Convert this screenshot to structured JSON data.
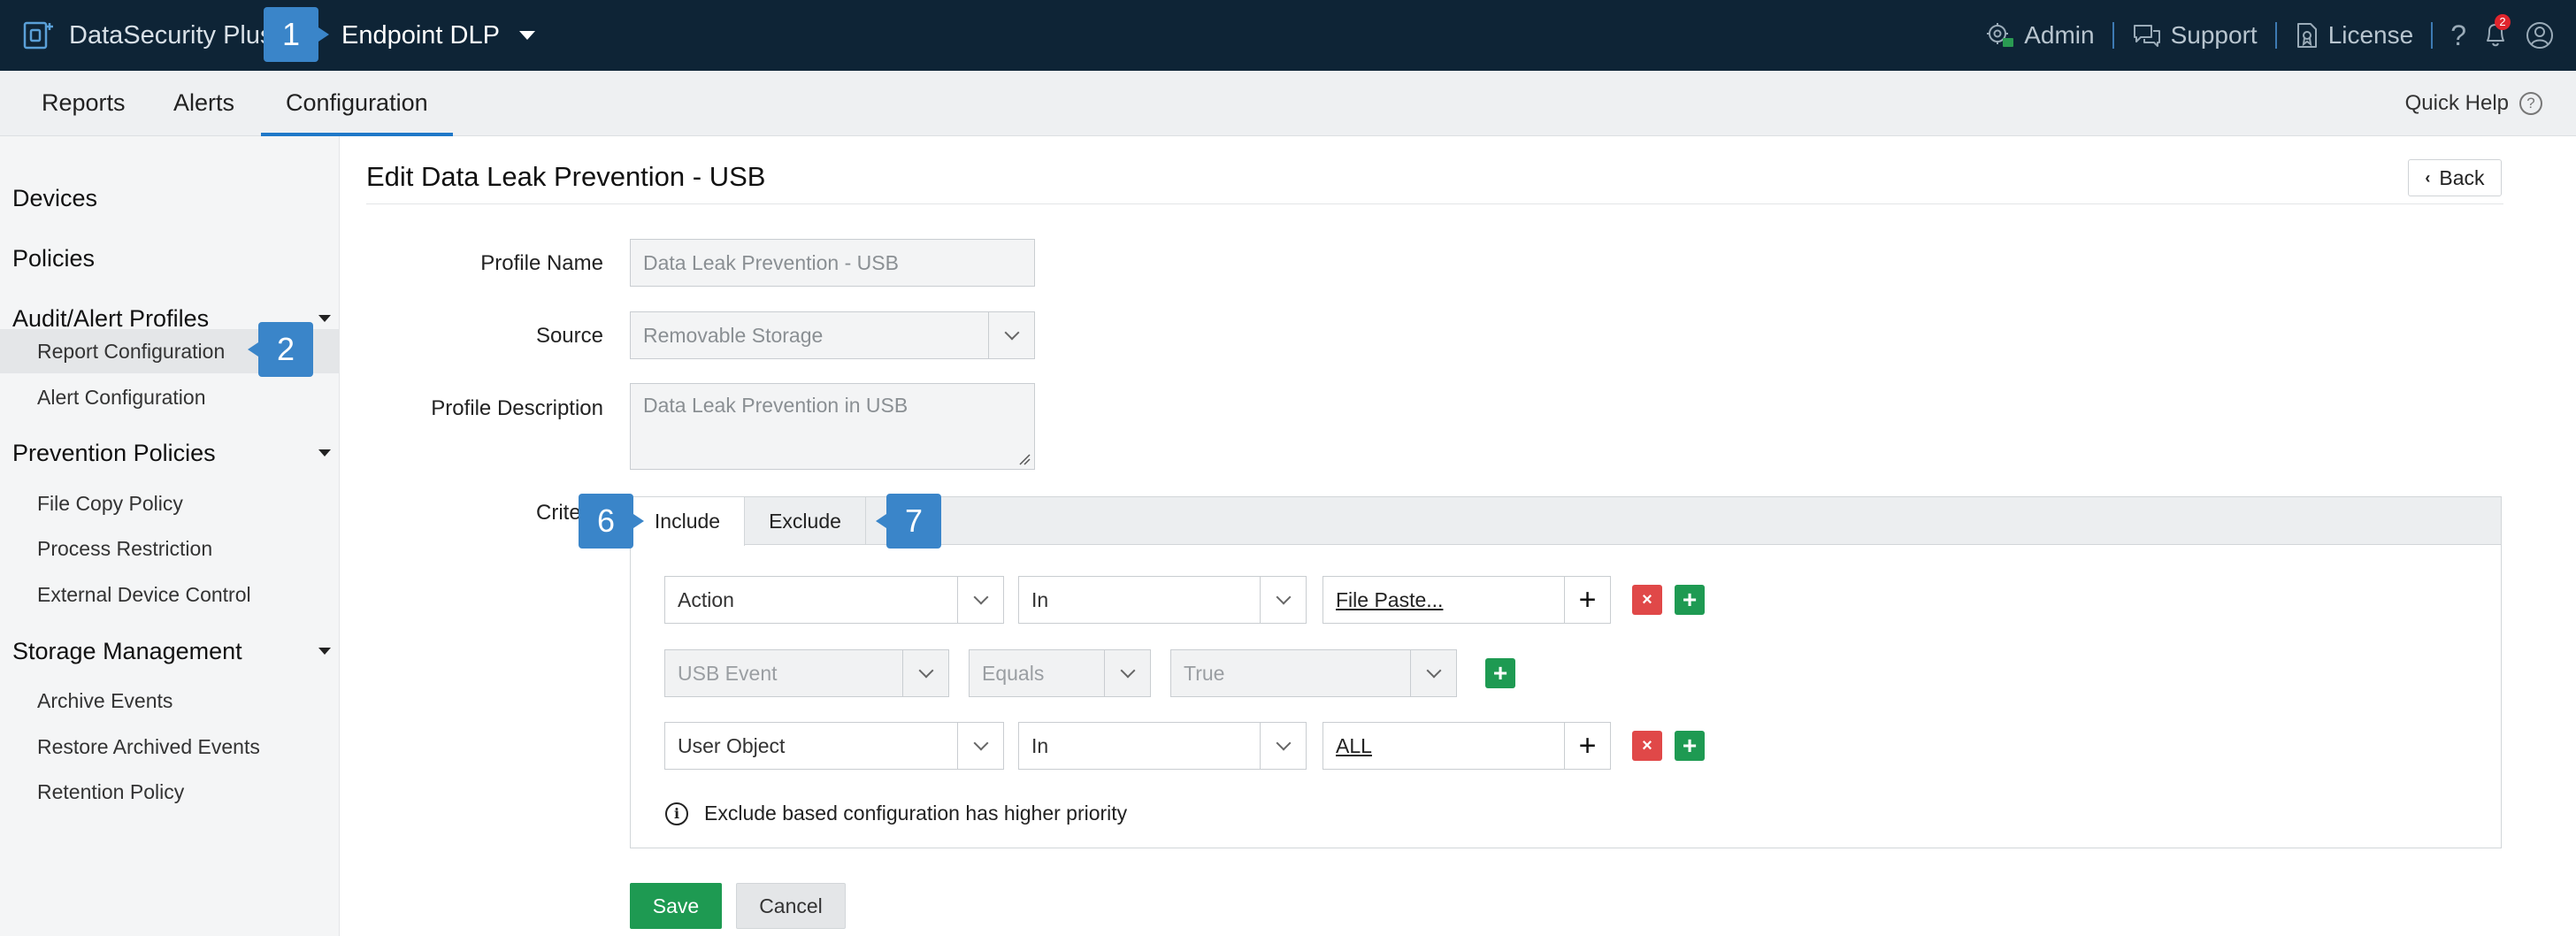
{
  "app": {
    "product_name": "DataSecurity Plus",
    "module_name": "Endpoint DLP"
  },
  "topbar": {
    "admin_label": "Admin",
    "support_label": "Support",
    "license_label": "License",
    "help_glyph": "?",
    "notification_count": "2"
  },
  "nav": {
    "tabs": [
      {
        "label": "Reports"
      },
      {
        "label": "Alerts"
      },
      {
        "label": "Configuration",
        "active": true
      }
    ],
    "quick_help_label": "Quick Help"
  },
  "sidebar": {
    "devices": "Devices",
    "policies": "Policies",
    "audit_alert_profiles": {
      "label": "Audit/Alert Profiles",
      "items": [
        "Report Configuration",
        "Alert Configuration"
      ]
    },
    "prevention_policies": {
      "label": "Prevention Policies",
      "items": [
        "File Copy Policy",
        "Process Restriction",
        "External Device Control"
      ]
    },
    "storage_management": {
      "label": "Storage Management",
      "items": [
        "Archive Events",
        "Restore Archived Events",
        "Retention Policy"
      ]
    }
  },
  "steps": {
    "s1": "1",
    "s2": "2",
    "s6": "6",
    "s7": "7"
  },
  "page": {
    "title": "Edit Data Leak Prevention - USB",
    "back_label": "Back"
  },
  "form": {
    "profile_name_label": "Profile Name",
    "profile_name_value": "Data Leak Prevention - USB",
    "source_label": "Source",
    "source_value": "Removable Storage",
    "description_label": "Profile Description",
    "description_value": "Data Leak Prevention in USB",
    "criteria_label": "Crite",
    "criteria_tabs": [
      "Include",
      "Exclude"
    ],
    "rows": [
      {
        "field": "Action",
        "operator": "In",
        "value": "File Paste..."
      },
      {
        "field": "USB Event",
        "operator": "Equals",
        "value": "True"
      },
      {
        "field": "User Object",
        "operator": "In",
        "value": "ALL"
      }
    ],
    "info_text": "Exclude based configuration has higher priority",
    "save_label": "Save",
    "cancel_label": "Cancel"
  },
  "colors": {
    "topbar": "#0e2436",
    "accent": "#1f78c8",
    "step_badge": "#3a85c9",
    "save_green": "#1e9a52",
    "remove_red": "#e04848"
  }
}
